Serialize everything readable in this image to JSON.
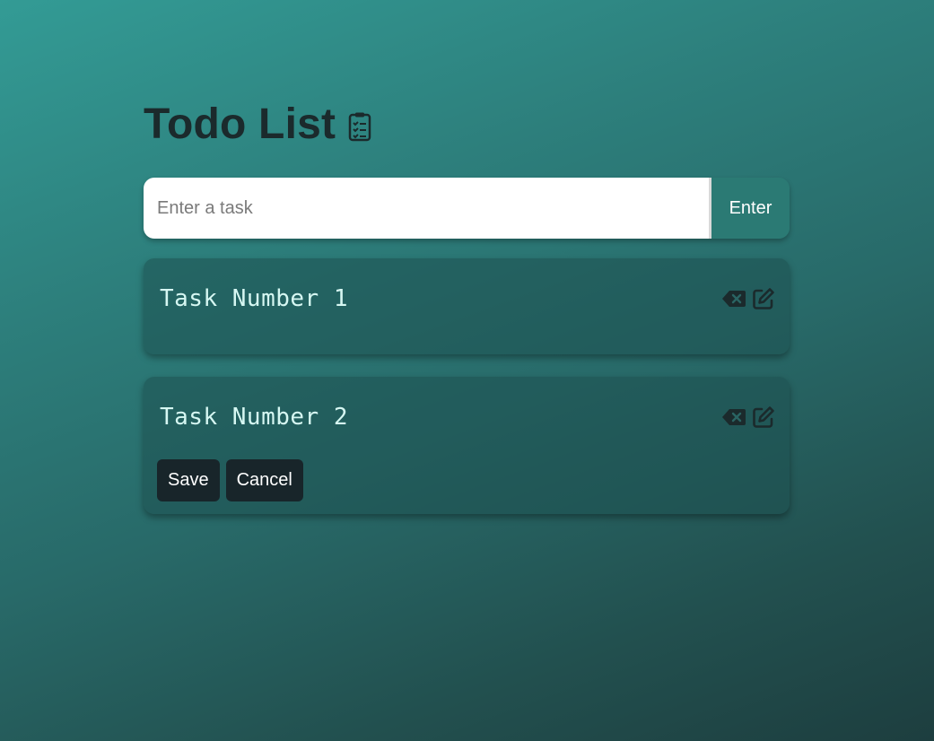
{
  "header": {
    "title": "Todo List",
    "title_icon": "clipboard-list-icon"
  },
  "input": {
    "placeholder": "Enter a task",
    "value": "",
    "submit_label": "Enter"
  },
  "tasks": [
    {
      "text": "Task Number 1",
      "editing": false,
      "actions": [
        "delete-icon",
        "edit-icon"
      ]
    },
    {
      "text": "Task Number 2",
      "editing": true,
      "actions": [
        "delete-icon",
        "edit-icon"
      ],
      "save_label": "Save",
      "cancel_label": "Cancel"
    }
  ],
  "colors": {
    "accent": "#2b7a74",
    "title": "#1b2a2c",
    "task_text": "#d6f7f2",
    "dark_button": "#18252a"
  }
}
